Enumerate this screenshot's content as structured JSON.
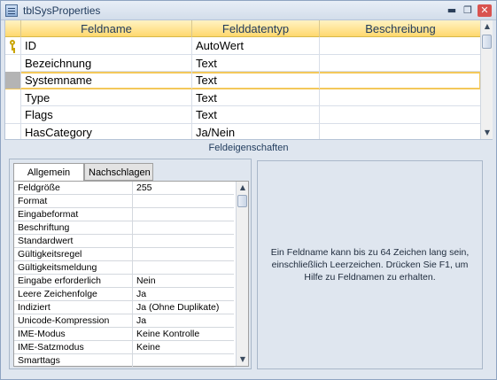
{
  "window": {
    "title": "tblSysProperties",
    "controls": {
      "minimize": "▬",
      "restore": "❐",
      "close": "✕"
    }
  },
  "grid": {
    "headers": [
      "Feldname",
      "Felddatentyp",
      "Beschreibung"
    ],
    "rows": [
      {
        "name": "ID",
        "type": "AutoWert",
        "description": "",
        "primary_key": true
      },
      {
        "name": "Bezeichnung",
        "type": "Text",
        "description": ""
      },
      {
        "name": "Systemname",
        "type": "Text",
        "description": "",
        "current": true
      },
      {
        "name": "Type",
        "type": "Text",
        "description": ""
      },
      {
        "name": "Flags",
        "type": "Text",
        "description": ""
      },
      {
        "name": "HasCategory",
        "type": "Ja/Nein",
        "description": ""
      }
    ]
  },
  "section_label": "Feldeigenschaften",
  "tabs": {
    "general": "Allgemein",
    "lookup": "Nachschlagen"
  },
  "properties": [
    {
      "key": "Feldgröße",
      "value": "255"
    },
    {
      "key": "Format",
      "value": ""
    },
    {
      "key": "Eingabeformat",
      "value": ""
    },
    {
      "key": "Beschriftung",
      "value": ""
    },
    {
      "key": "Standardwert",
      "value": ""
    },
    {
      "key": "Gültigkeitsregel",
      "value": ""
    },
    {
      "key": "Gültigkeitsmeldung",
      "value": ""
    },
    {
      "key": "Eingabe erforderlich",
      "value": "Nein"
    },
    {
      "key": "Leere Zeichenfolge",
      "value": "Ja"
    },
    {
      "key": "Indiziert",
      "value": "Ja (Ohne Duplikate)"
    },
    {
      "key": "Unicode-Kompression",
      "value": "Ja"
    },
    {
      "key": "IME-Modus",
      "value": "Keine Kontrolle"
    },
    {
      "key": "IME-Satzmodus",
      "value": "Keine"
    },
    {
      "key": "Smarttags",
      "value": ""
    }
  ],
  "help_text": "Ein Feldname kann bis zu 64 Zeichen lang sein, einschließlich Leerzeichen. Drücken Sie F1, um Hilfe zu Feldnamen zu erhalten.",
  "scroll": {
    "up": "▲",
    "down": "▼"
  }
}
